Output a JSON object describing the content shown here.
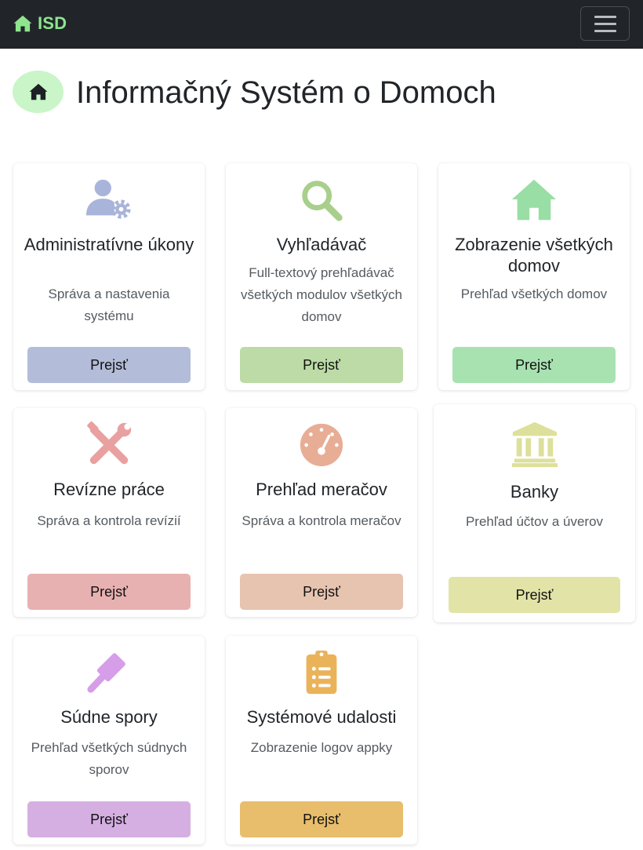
{
  "navbar": {
    "brand": "ISD",
    "brand_color": "#8ee58e",
    "toggle_icon": "hamburger-icon"
  },
  "header": {
    "title": "Informačný Systém o Domoch",
    "icon": "home-icon",
    "badge_color": "#c9f5c9"
  },
  "cards": [
    {
      "title": "Administratívne úkony",
      "text": "Správa a nastavenia systému",
      "button": "Prejsť",
      "icon": "user-gear-icon",
      "color": "#b3bcd8"
    },
    {
      "title": "Vyhľadávač",
      "text": "Full-textový prehľadávač všetkých modulov všetkých domov",
      "button": "Prejsť",
      "icon": "magnifier-icon",
      "color": "#bcdba6"
    },
    {
      "title": "Zobrazenie všetkých domov",
      "text": "Prehľad všetkých domov",
      "button": "Prejsť",
      "icon": "house-icon",
      "color": "#a8e2b1"
    },
    {
      "title": "Revízne práce",
      "text": "Správa a kontrola revízií",
      "button": "Prejsť",
      "icon": "tools-icon",
      "color": "#e8b1b1"
    },
    {
      "title": "Prehľad meračov",
      "text": "Správa a kontrola meračov",
      "button": "Prejsť",
      "icon": "gauge-icon",
      "color": "#e7c4b0"
    },
    {
      "title": "Banky",
      "text": "Prehľad účtov a úverov",
      "button": "Prejsť",
      "icon": "bank-icon",
      "color": "#e2e3a7"
    },
    {
      "title": "Súdne spory",
      "text": "Prehľad všetkých súdnych sporov",
      "button": "Prejsť",
      "icon": "gavel-icon",
      "color": "#d5afe2"
    },
    {
      "title": "Systémové udalosti",
      "text": "Zobrazenie logov appky",
      "button": "Prejsť",
      "icon": "clipboard-list-icon",
      "color": "#e8bd6c"
    }
  ]
}
